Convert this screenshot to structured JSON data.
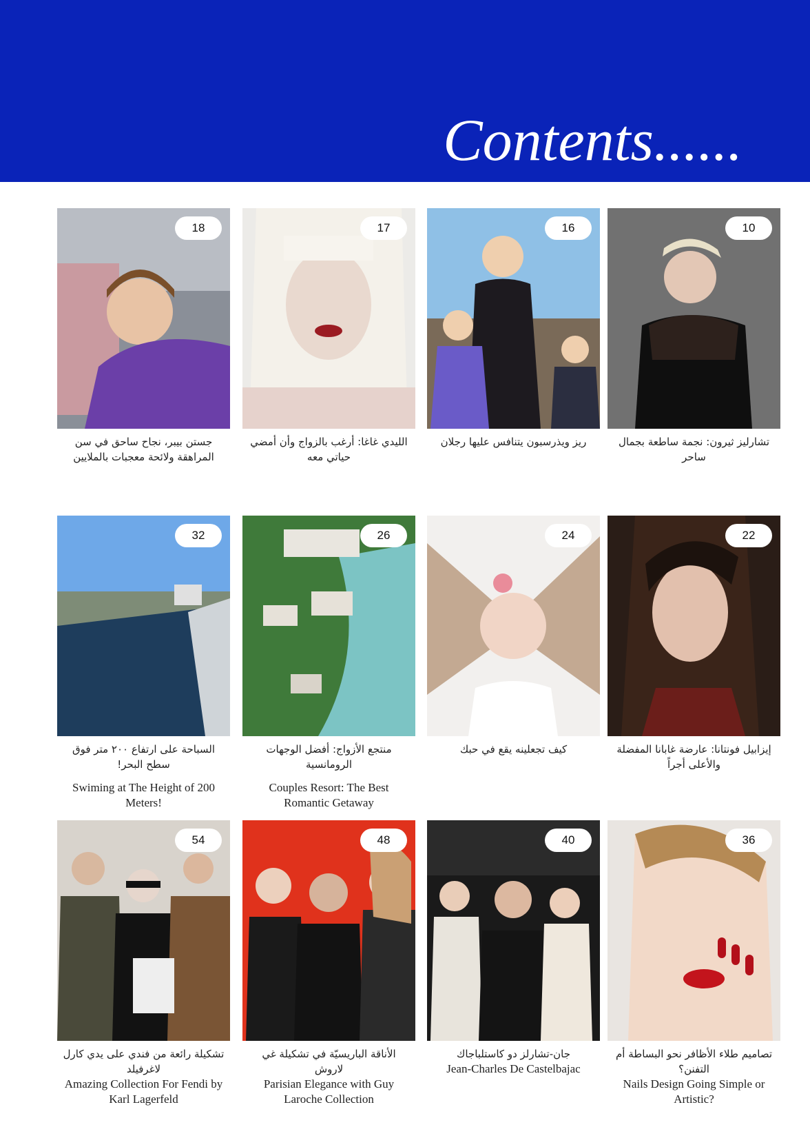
{
  "header": {
    "title": "Contents......",
    "background": "#0a23b8"
  },
  "articles": [
    {
      "page": "18",
      "ar": "جستن بيبر، نجاح ساحق في سن المراهقة ولائحة معجبات بالملايين",
      "en": "",
      "photo": "teen-singer-at-window"
    },
    {
      "page": "17",
      "ar": "الليدي غاغا: أرغب بالزواج وأن أمضي حياتي معه",
      "en": "",
      "photo": "platinum-hair-portrait"
    },
    {
      "page": "16",
      "ar": "ريز ويذرسبون يتنافس عليها رجلان",
      "en": "",
      "photo": "actress-with-children"
    },
    {
      "page": "10",
      "ar": "تشارليز ثيرون: نجمة ساطعة بجمال ساحر",
      "en": "",
      "photo": "blonde-in-black-dress"
    },
    {
      "page": "32",
      "ar": "السباحة على ارتفاع ٢٠٠ متر فوق سطح البحر!",
      "en": "Swiming at The Height of 200 Meters!",
      "photo": "rooftop-infinity-pool"
    },
    {
      "page": "26",
      "ar": "منتجع الأزواج: أفضل الوجهات الرومانسية",
      "en": "Couples Resort: The Best Romantic Getaway",
      "photo": "aerial-beach-resort"
    },
    {
      "page": "24",
      "ar": "كيف تجعلينه يقع في حبك",
      "en": "",
      "photo": "woman-flying-hair"
    },
    {
      "page": "22",
      "ar": "إيزابيل فونتانا: عارضة غابانا المفضلة والأعلى أجراً",
      "en": "",
      "photo": "brunette-model-portrait"
    },
    {
      "page": "54",
      "ar": "تشكيلة رائعة من فندي على يدي كارل لاغرفيلد",
      "en": "Amazing Collection For Fendi by Karl Lagerfeld",
      "photo": "designer-with-models"
    },
    {
      "page": "48",
      "ar": "الأناقة الباريسيّة في تشكيلة غي لاروش",
      "en": "Parisian Elegance with Guy Laroche Collection",
      "photo": "designer-with-models-red"
    },
    {
      "page": "40",
      "ar": "جان-تشارلز دو كاستلباجاك",
      "en": "Jean-Charles De Castelbajac",
      "photo": "runway-designer"
    },
    {
      "page": "36",
      "ar": "تصاميم طلاء الأظافر نحو البساطة أم التفنن؟",
      "en": "Nails Design Going Simple or Artistic?",
      "photo": "red-nails-portrait"
    }
  ]
}
